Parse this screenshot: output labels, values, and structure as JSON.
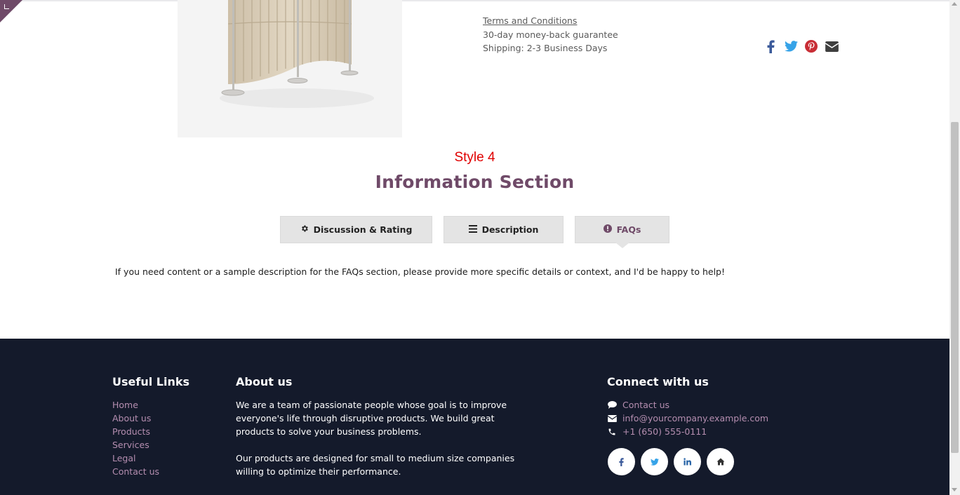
{
  "policy": {
    "terms_link": "Terms and Conditions",
    "guarantee": "30-day money-back guarantee",
    "shipping": "Shipping: 2-3 Business Days"
  },
  "share_icons": [
    "facebook-icon",
    "twitter-icon",
    "pinterest-icon",
    "envelope-icon"
  ],
  "section": {
    "style_label": "Style 4",
    "title": "Information Section"
  },
  "tabs": [
    {
      "label": "Discussion & Rating",
      "icon": "gear-icon"
    },
    {
      "label": "Description",
      "icon": "list-icon"
    },
    {
      "label": "FAQs",
      "icon": "info-icon",
      "active": true
    }
  ],
  "faq_text": "If you need content or a sample description for the FAQs section, please provide more specific details or context, and I'd be happy to help!",
  "footer": {
    "useful_links_title": "Useful Links",
    "links": [
      "Home",
      "About us",
      "Products",
      "Services",
      "Legal",
      "Contact us"
    ],
    "about_title": "About us",
    "about_p1": "We are a team of passionate people whose goal is to improve everyone's life through disruptive products. We build great products to solve your business problems.",
    "about_p2": "Our products are designed for small to medium size companies willing to optimize their performance.",
    "connect_title": "Connect with us",
    "contact_us": "Contact us",
    "email": "info@yourcompany.example.com",
    "phone": "+1 (650) 555-0111",
    "social": [
      "facebook-icon",
      "twitter-icon",
      "linkedin-icon",
      "home-icon"
    ]
  },
  "colors": {
    "brand": "#6f4a68",
    "accent_red": "#e00000",
    "footer_bg": "#141a2b",
    "link": "#b58eb0"
  }
}
